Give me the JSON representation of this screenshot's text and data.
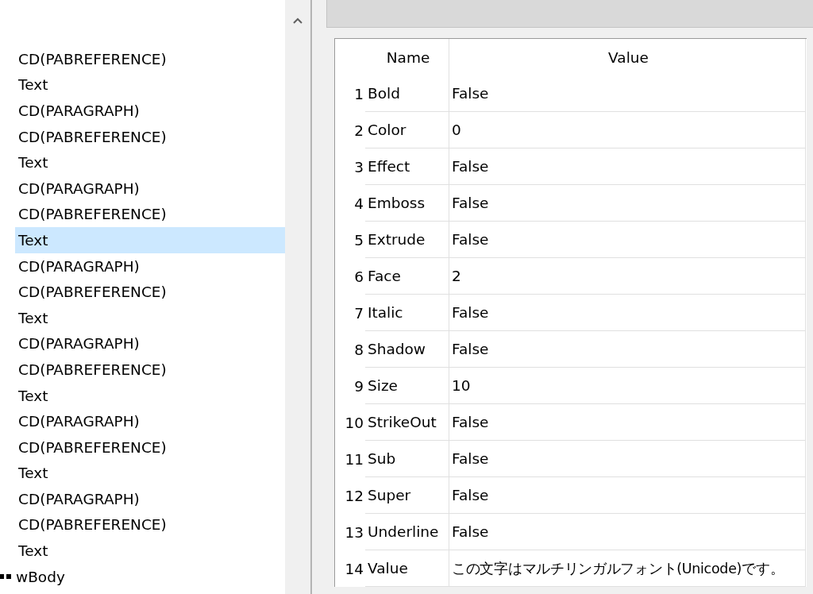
{
  "tree": {
    "items": [
      {
        "label": "CD(PABREFERENCE)",
        "kind": "leaf",
        "selected": false
      },
      {
        "label": "Text",
        "kind": "leaf",
        "selected": false
      },
      {
        "label": "CD(PARAGRAPH)",
        "kind": "leaf",
        "selected": false
      },
      {
        "label": "CD(PABREFERENCE)",
        "kind": "leaf",
        "selected": false
      },
      {
        "label": "Text",
        "kind": "leaf",
        "selected": false
      },
      {
        "label": "CD(PARAGRAPH)",
        "kind": "leaf",
        "selected": false
      },
      {
        "label": "CD(PABREFERENCE)",
        "kind": "leaf",
        "selected": false
      },
      {
        "label": "Text",
        "kind": "leaf",
        "selected": true
      },
      {
        "label": "CD(PARAGRAPH)",
        "kind": "leaf",
        "selected": false
      },
      {
        "label": "CD(PABREFERENCE)",
        "kind": "leaf",
        "selected": false
      },
      {
        "label": "Text",
        "kind": "leaf",
        "selected": false
      },
      {
        "label": "CD(PARAGRAPH)",
        "kind": "leaf",
        "selected": false
      },
      {
        "label": "CD(PABREFERENCE)",
        "kind": "leaf",
        "selected": false
      },
      {
        "label": "Text",
        "kind": "leaf",
        "selected": false
      },
      {
        "label": "CD(PARAGRAPH)",
        "kind": "leaf",
        "selected": false
      },
      {
        "label": "CD(PABREFERENCE)",
        "kind": "leaf",
        "selected": false
      },
      {
        "label": "Text",
        "kind": "leaf",
        "selected": false
      },
      {
        "label": "CD(PARAGRAPH)",
        "kind": "leaf",
        "selected": false
      },
      {
        "label": "CD(PABREFERENCE)",
        "kind": "leaf",
        "selected": false
      },
      {
        "label": "Text",
        "kind": "leaf",
        "selected": false
      },
      {
        "label": "wBody",
        "kind": "branch",
        "selected": false
      }
    ]
  },
  "table": {
    "columns": [
      "Name",
      "Value"
    ],
    "rows": [
      {
        "number": "1",
        "name": "Bold",
        "value": "False"
      },
      {
        "number": "2",
        "name": "Color",
        "value": "0"
      },
      {
        "number": "3",
        "name": "Effect",
        "value": "False"
      },
      {
        "number": "4",
        "name": "Emboss",
        "value": "False"
      },
      {
        "number": "5",
        "name": "Extrude",
        "value": "False"
      },
      {
        "number": "6",
        "name": "Face",
        "value": "2"
      },
      {
        "number": "7",
        "name": "Italic",
        "value": "False"
      },
      {
        "number": "8",
        "name": "Shadow",
        "value": "False"
      },
      {
        "number": "9",
        "name": "Size",
        "value": "10"
      },
      {
        "number": "10",
        "name": "StrikeOut",
        "value": "False"
      },
      {
        "number": "11",
        "name": "Sub",
        "value": "False"
      },
      {
        "number": "12",
        "name": "Super",
        "value": "False"
      },
      {
        "number": "13",
        "name": "Underline",
        "value": "False"
      },
      {
        "number": "14",
        "name": "Value",
        "value": "この文字はマルチリンガルフォント(Unicode)です。"
      }
    ]
  }
}
